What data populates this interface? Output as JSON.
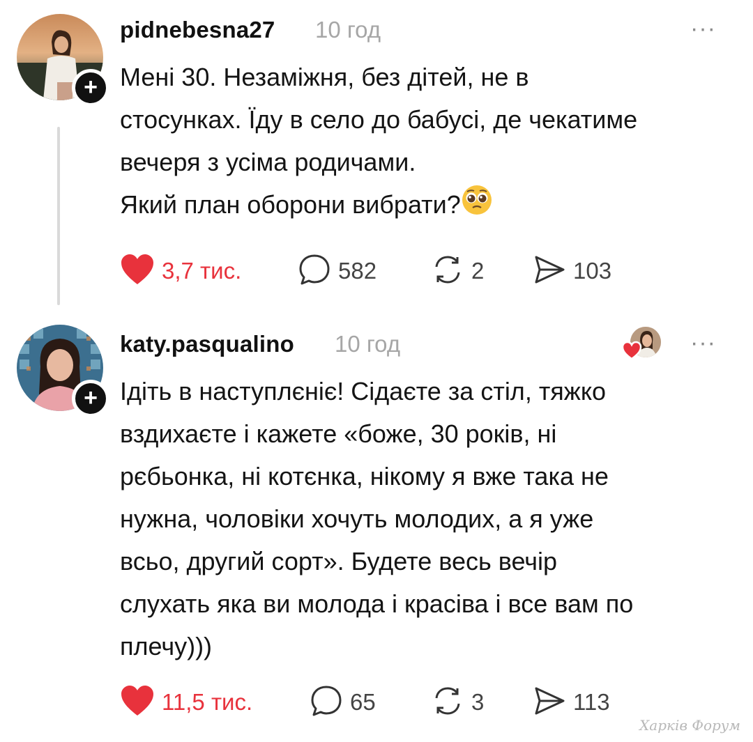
{
  "posts": [
    {
      "username": "pidnebesna27",
      "time": "10 год",
      "more": "···",
      "follow": "+",
      "text": "Мені 30. Незаміжня, без дітей, не в\nстосунках. Їду в село до бабусі, де чекатиме\nвечеря з усіма родичами.\nЯкий план оборони вибрати?",
      "emoji": "pleading-face-emoji",
      "likes": "3,7 тис.",
      "comments": "582",
      "reposts": "2",
      "shares": "103",
      "liked": true
    },
    {
      "username": "katy.pasqualino",
      "time": "10 год",
      "more": "···",
      "follow": "+",
      "text": "Ідіть в наступлєніє! Сідаєте за стіл, тяжко\nвздихаєте і кажете «боже, 30 років, ні\nрєбьонка, ні котєнка, нікому я вже така не\nнужна, чоловіки хочуть молодих, а я уже\nвсьо, другий сорт». Будете весь вечір\nслухать яка ви молода і красіва і все вам по\nплечу)))",
      "likes": "11,5 тис.",
      "comments": "65",
      "reposts": "3",
      "shares": "113",
      "liked": true,
      "liked_by_author_badge": "liked-by-author-avatar"
    }
  ],
  "watermark": "Харків Форум",
  "colors": {
    "like": "#e8323c",
    "text": "#141414",
    "muted": "#a6a6a6",
    "icon": "#444444"
  }
}
